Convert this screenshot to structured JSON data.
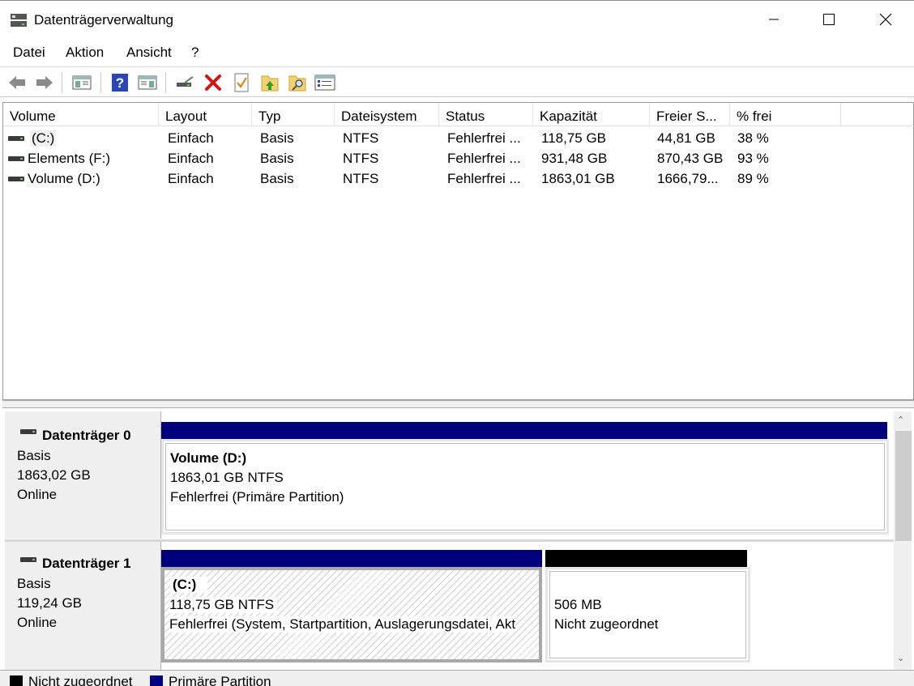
{
  "window": {
    "title": "Datenträgerverwaltung"
  },
  "menu": {
    "items": [
      "Datei",
      "Aktion",
      "Ansicht",
      "?"
    ]
  },
  "toolbar": {
    "icons": [
      "back-arrow-icon",
      "forward-arrow-icon",
      "console-tree-icon",
      "help-icon",
      "properties-view-icon",
      "connect-drive-icon",
      "delete-icon",
      "check-icon",
      "folder-up-icon",
      "folder-search-icon",
      "settings-list-icon"
    ]
  },
  "volumes": {
    "columns": [
      "Volume",
      "Layout",
      "Typ",
      "Dateisystem",
      "Status",
      "Kapazität",
      "Freier S...",
      "% frei"
    ],
    "rows": [
      {
        "volume": "(C:)",
        "layout": "Einfach",
        "typ": "Basis",
        "fs": "NTFS",
        "status": "Fehlerfrei ...",
        "capacity": "118,75 GB",
        "free": "44,81 GB",
        "pct": "38 %"
      },
      {
        "volume": "Elements (F:)",
        "layout": "Einfach",
        "typ": "Basis",
        "fs": "NTFS",
        "status": "Fehlerfrei ...",
        "capacity": "931,48 GB",
        "free": "870,43 GB",
        "pct": "93 %"
      },
      {
        "volume": "Volume (D:)",
        "layout": "Einfach",
        "typ": "Basis",
        "fs": "NTFS",
        "status": "Fehlerfrei ...",
        "capacity": "1863,01 GB",
        "free": "1666,79...",
        "pct": "89 %"
      }
    ]
  },
  "disks": [
    {
      "name": "Datenträger 0",
      "type": "Basis",
      "size": "1863,02 GB",
      "state": "Online",
      "partitions": [
        {
          "title": "Volume  (D:)",
          "size": "1863,01 GB NTFS",
          "status": "Fehlerfrei (Primäre Partition)"
        }
      ]
    },
    {
      "name": "Datenträger 1",
      "type": "Basis",
      "size": "119,24 GB",
      "state": "Online",
      "partitions": [
        {
          "title": "(C:)",
          "size": "118,75 GB NTFS",
          "status": "Fehlerfrei (System, Startpartition, Auslagerungsdatei, Akt"
        },
        {
          "size": "506 MB",
          "status": "Nicht zugeordnet"
        }
      ]
    }
  ],
  "legend": {
    "unallocated": "Nicht zugeordnet",
    "primary": "Primäre Partition"
  },
  "colors": {
    "primary_partition": "#00007f",
    "unallocated": "#000000"
  }
}
